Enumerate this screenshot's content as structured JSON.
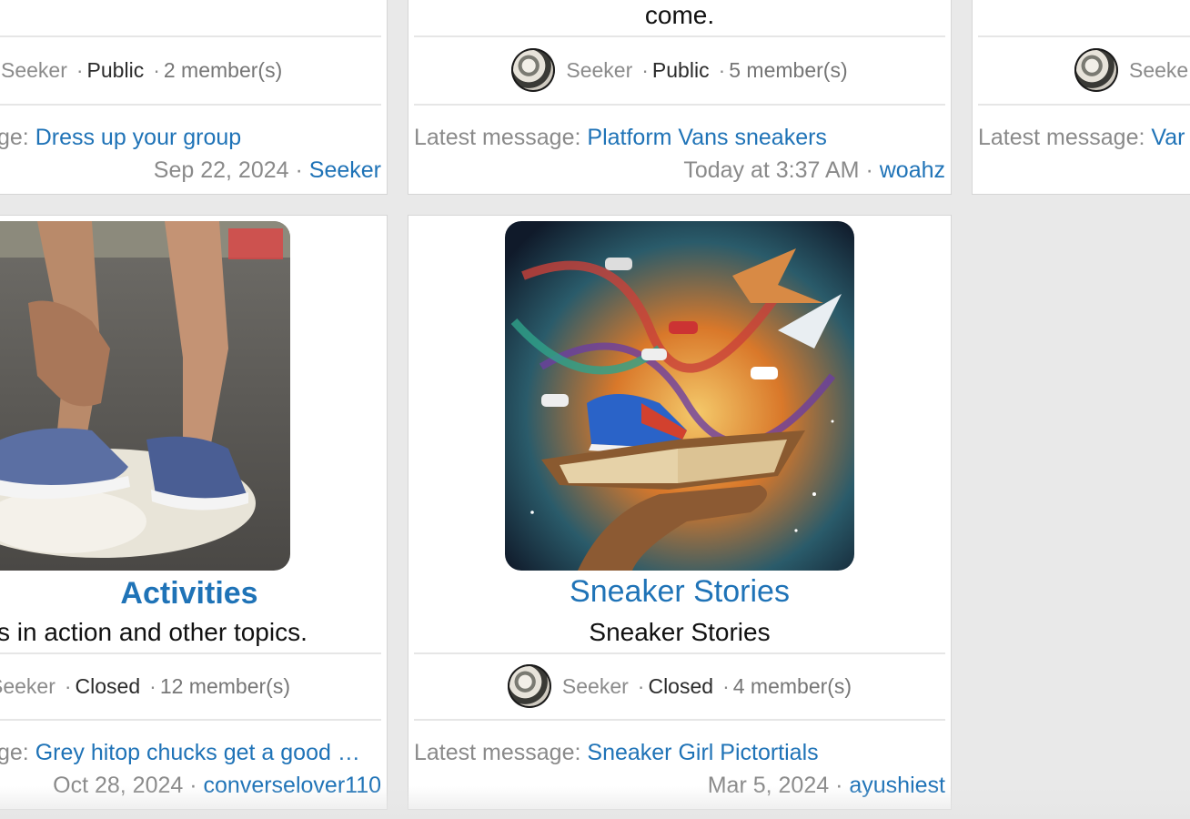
{
  "cards_top": [
    {
      "owner": "Seeker",
      "privacy": "Public",
      "members": "2 member(s)",
      "latest_prefix": "ge: ",
      "latest_title": "Dress up your group",
      "date": "Sep 22, 2024",
      "author": "Seeker"
    },
    {
      "desc_tail": "come.",
      "owner": "Seeker",
      "privacy": "Public",
      "members": "5 member(s)",
      "latest_prefix": "Latest message: ",
      "latest_title": "Platform Vans sneakers",
      "date": "Today at 3:37 AM",
      "author": "woahz"
    },
    {
      "owner": "Seeke",
      "latest_prefix": "Latest message: ",
      "latest_title": "Var"
    }
  ],
  "cards_bottom": [
    {
      "title": "Activities",
      "desc": "s in action and other topics.",
      "owner": "Seeker",
      "privacy": "Closed",
      "members": "12 member(s)",
      "latest_prefix": "ge: ",
      "latest_title": "Grey hitop chucks get a good …",
      "date": "Oct 28, 2024",
      "author": "converselover110"
    },
    {
      "title": "Sneaker Stories",
      "desc": "Sneaker Stories",
      "owner": "Seeker",
      "privacy": "Closed",
      "members": "4 member(s)",
      "latest_prefix": "Latest message: ",
      "latest_title": "Sneaker Girl Pictortials",
      "date": "Mar 5, 2024",
      "author": "ayushiest"
    }
  ],
  "separator_dot": "·"
}
